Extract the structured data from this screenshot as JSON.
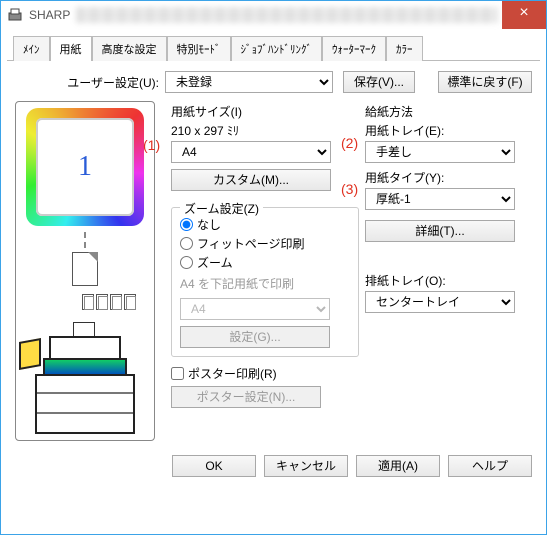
{
  "window": {
    "title": "SHARP"
  },
  "tabs": [
    "ﾒｲﾝ",
    "用紙",
    "高度な設定",
    "特別ﾓｰﾄﾞ",
    "ｼﾞｮﾌﾞﾊﾝﾄﾞﾘﾝｸﾞ",
    "ｳｫｰﾀｰﾏｰｸ",
    "ｶﾗｰ"
  ],
  "active_tab_index": 1,
  "user_settings": {
    "label": "ユーザー設定(U):",
    "value": "未登録",
    "save": "保存(V)...",
    "restore": "標準に戻す(F)"
  },
  "annotations": {
    "a1": "(1)",
    "a2": "(2)",
    "a3": "(3)"
  },
  "preview": {
    "page_number": "1"
  },
  "paper_size": {
    "label": "用紙サイズ(I)",
    "dims": "210 x 297 ﾐﾘ",
    "value": "A4",
    "custom": "カスタム(M)..."
  },
  "zoom": {
    "label": "ズーム設定(Z)",
    "options": [
      "なし",
      "フィットページ印刷",
      "ズーム"
    ],
    "selected_index": 0,
    "hint": "A4 を下記用紙で印刷",
    "target_value": "A4",
    "settings": "設定(G)..."
  },
  "poster": {
    "check_label": "ポスター印刷(R)",
    "settings": "ポスター設定(N)..."
  },
  "feed": {
    "method_label": "給紙方法",
    "tray_label": "用紙トレイ(E):",
    "tray_value": "手差し",
    "type_label": "用紙タイプ(Y):",
    "type_value": "厚紙-1",
    "detail": "詳細(T)..."
  },
  "output": {
    "label": "排紙トレイ(O):",
    "value": "センタートレイ"
  },
  "footer": {
    "ok": "OK",
    "cancel": "キャンセル",
    "apply": "適用(A)",
    "help": "ヘルプ"
  }
}
